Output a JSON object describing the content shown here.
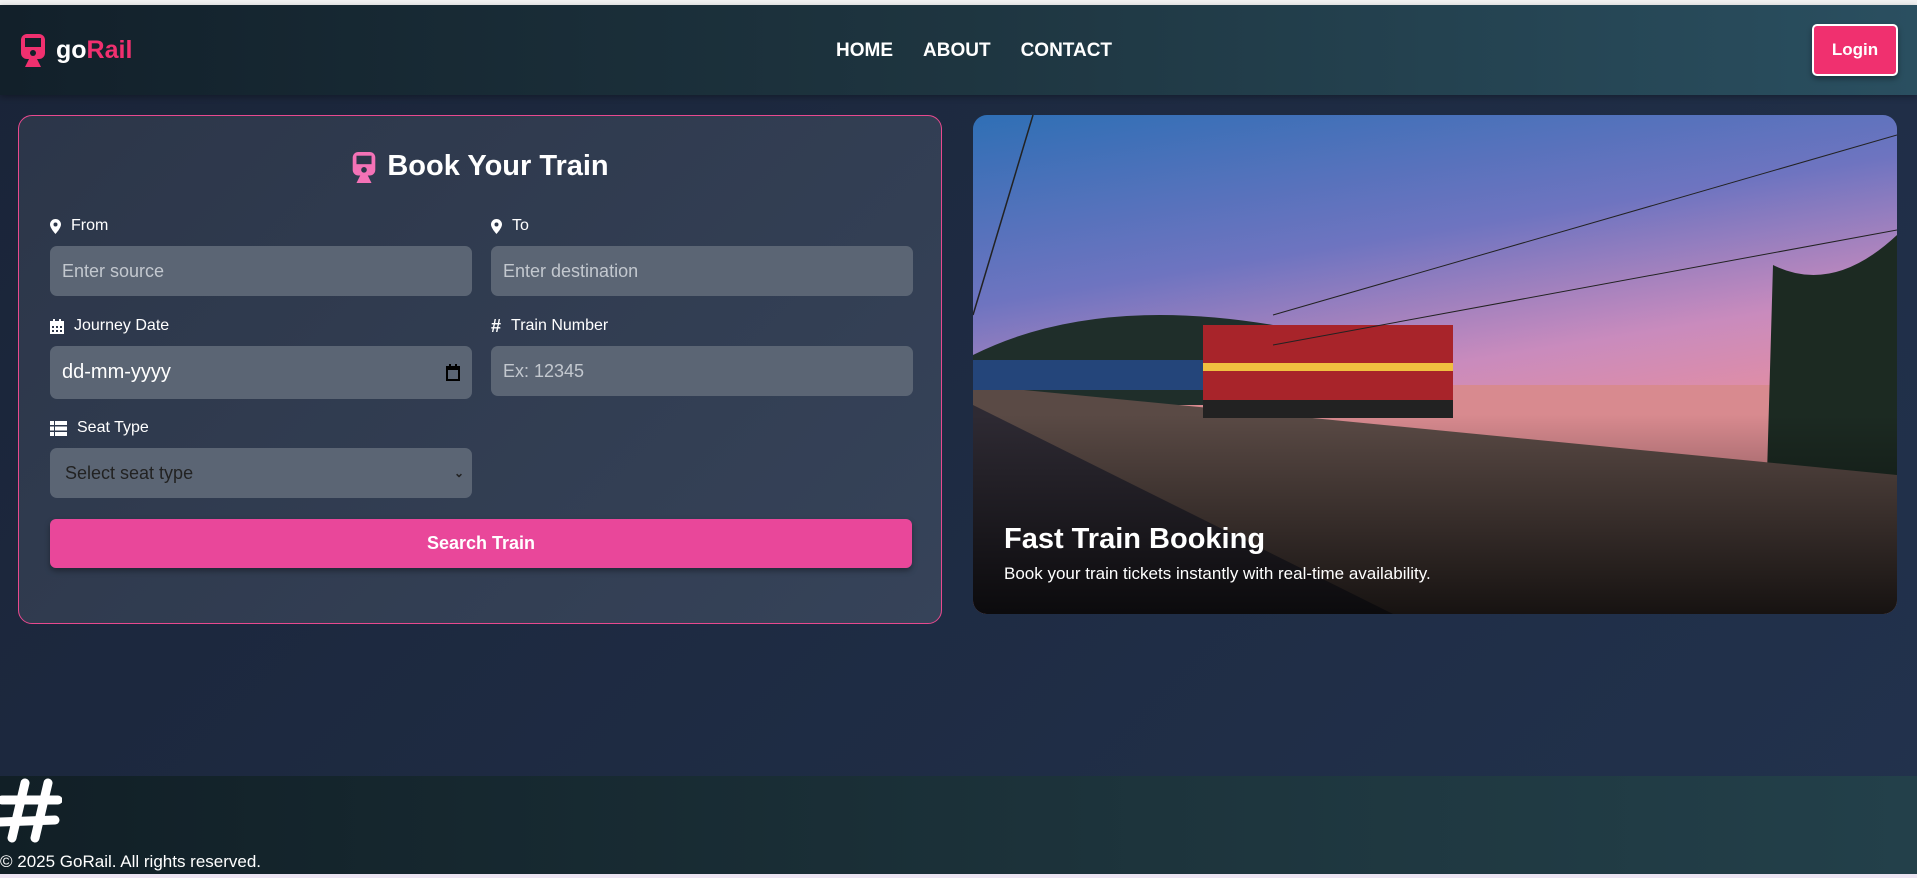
{
  "brand": {
    "prefix": "go",
    "suffix": "Rail",
    "accent": "#f0306f"
  },
  "nav": {
    "links": [
      "HOME",
      "ABOUT",
      "CONTACT"
    ],
    "login": "Login"
  },
  "form": {
    "title": "Book Your Train",
    "from": {
      "label": "From",
      "placeholder": "Enter source",
      "icon": "map-marker-icon"
    },
    "to": {
      "label": "To",
      "placeholder": "Enter destination",
      "icon": "map-marker-icon"
    },
    "date": {
      "label": "Journey Date",
      "value": "dd-mm-yyyy",
      "icon": "calendar-icon"
    },
    "train_number": {
      "label": "Train Number",
      "placeholder": "Ex: 12345",
      "icon": "hashtag-icon"
    },
    "seat_type": {
      "label": "Seat Type",
      "selected": "Select seat type",
      "icon": "list-icon"
    },
    "submit": "Search Train",
    "button_color": "#e9479a"
  },
  "hero": {
    "title": "Fast Train Booking",
    "subtitle": "Book your train tickets instantly with real-time availability."
  },
  "footer": {
    "copyright": "© 2025 GoRail. All rights reserved."
  }
}
